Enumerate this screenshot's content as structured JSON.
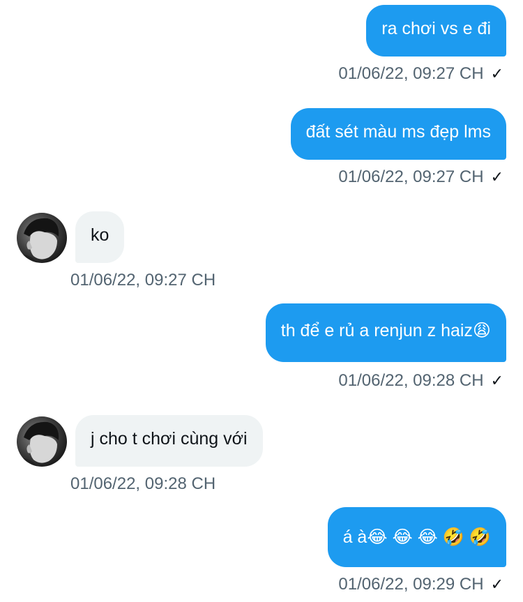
{
  "colors": {
    "outgoing_bubble": "#1d9bf0",
    "incoming_bubble": "#eff3f4",
    "timestamp": "#536471"
  },
  "messages": [
    {
      "direction": "outgoing",
      "text": "ra chơi vs e đi",
      "time": "01/06/22, 09:27 CH",
      "status": "✓"
    },
    {
      "direction": "outgoing",
      "text": "đất sét màu ms đẹp lms",
      "time": "01/06/22, 09:27 CH",
      "status": "✓"
    },
    {
      "direction": "incoming",
      "text": "ko",
      "time": "01/06/22, 09:27 CH",
      "avatar": "user-avatar"
    },
    {
      "direction": "outgoing",
      "text": "th để e rủ a renjun z haiz😩",
      "time": "01/06/22, 09:28 CH",
      "status": "✓"
    },
    {
      "direction": "incoming",
      "text": "j cho t chơi cùng với",
      "time": "01/06/22, 09:28 CH",
      "avatar": "user-avatar"
    },
    {
      "direction": "outgoing",
      "text": "á à😂 😂 😂 🤣 🤣",
      "time": "01/06/22, 09:29 CH",
      "status": "✓"
    }
  ]
}
